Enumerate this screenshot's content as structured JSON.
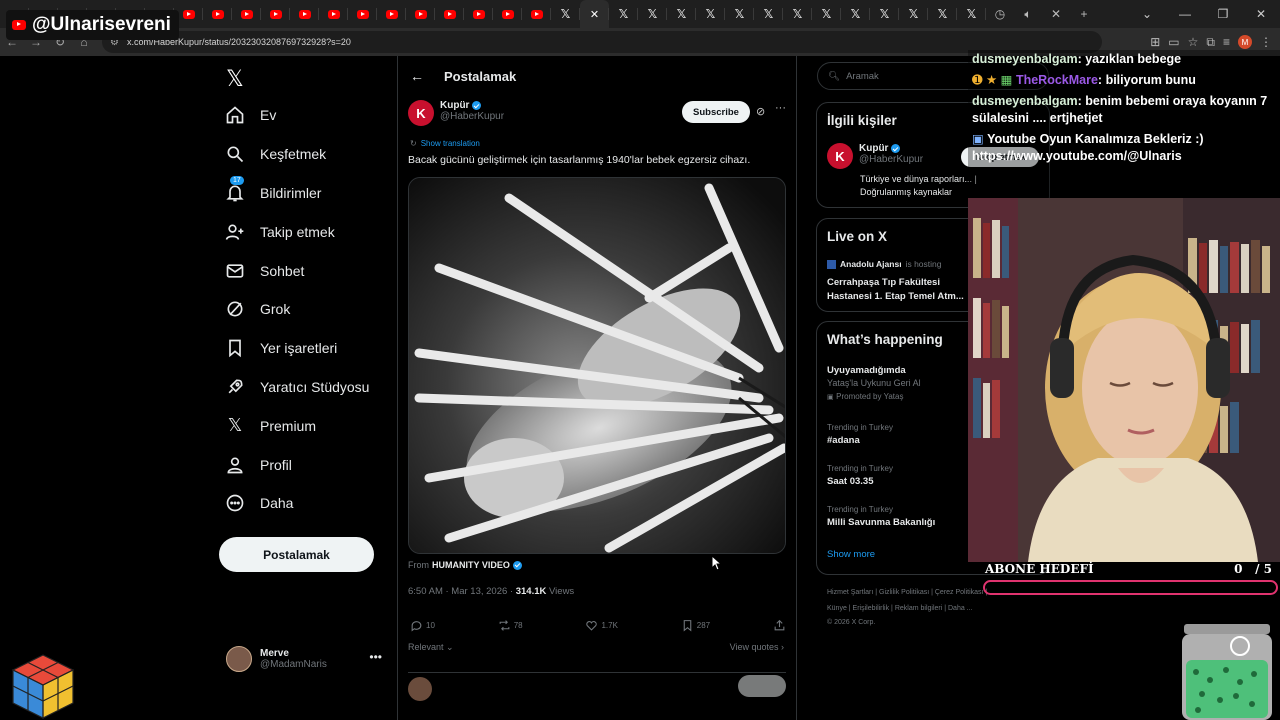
{
  "stream": {
    "channel_badge": "@Ulnarisevreni",
    "chat": [
      {
        "user": "dusmeyenbalgam",
        "text": "yazıklan bebege"
      },
      {
        "user": "TheRockMare",
        "text": "biliyorum bunu"
      },
      {
        "user": "dusmeyenbalgam",
        "text": "benim bebemi oraya koyanın 7 sülalesini .... ertjhetjet"
      },
      {
        "user": "",
        "text": "Youtube Oyun Kanalımıza Bekleriz :) https://www.youtube.com/@Ulnaris"
      }
    ],
    "goal_label": "ABONE HEDEFİ",
    "goal_current": "0",
    "goal_sep": "/",
    "goal_target": "5",
    "goal_fraction": 0
  },
  "browser": {
    "url": "x.com/HaberKupur/status/2032303208769732928?s=20"
  },
  "nav": {
    "items": [
      {
        "label": "Ev",
        "icon": "home-icon"
      },
      {
        "label": "Keşfetmek",
        "icon": "search-icon"
      },
      {
        "label": "Bildirimler",
        "icon": "bell-icon",
        "badge": "17"
      },
      {
        "label": "Takip etmek",
        "icon": "add-user-icon"
      },
      {
        "label": "Sohbet",
        "icon": "mail-icon"
      },
      {
        "label": "Grok",
        "icon": "grok-icon"
      },
      {
        "label": "Yer işaretleri",
        "icon": "bookmark-icon"
      },
      {
        "label": "Yaratıcı Stüdyosu",
        "icon": "rocket-icon"
      },
      {
        "label": "Premium",
        "icon": "x-logo-icon"
      },
      {
        "label": "Profil",
        "icon": "person-icon"
      },
      {
        "label": "Daha",
        "icon": "more-circle-icon"
      }
    ],
    "post_button": "Postalamak",
    "profile_name": "Merve",
    "profile_handle": "@MadamNaris"
  },
  "main": {
    "header_title": "Postalamak",
    "author_name": "Kupür",
    "author_handle": "@HaberKupur",
    "author_initial": "K",
    "subscribe": "Subscribe",
    "show_translation": "Show translation",
    "text": "Bacak gücünü geliştirmek için tasarlanmış 1940'lar bebek egzersiz cihazı.",
    "from_label": "From",
    "from_source": "HUMANITY VIDEO",
    "time": "6:50 AM · Mar 13, 2026 ·",
    "views_count": "314.1K",
    "views_label": "Views",
    "replies": "10",
    "reposts": "78",
    "likes": "1.7K",
    "bookmarks": "287",
    "relevant": "Relevant",
    "view_quotes": "View quotes"
  },
  "right": {
    "search_placeholder": "Aramak",
    "related_title": "İlgili kişiler",
    "related_name": "Kupür",
    "related_handle": "@HaberKupur",
    "related_desc": "Türkiye ve dünya raporları... | Doğrulanmış kaynaklar",
    "follow": "Takip etmek",
    "live_title": "Live on X",
    "live_host": "Anadolu Ajansı",
    "live_host_suffix": "is hosting",
    "live_event": "Cerrahpaşa Tıp Fakültesi Hastanesi 1. Etap Temel Atm...",
    "happening_title": "What’s happening",
    "trends": [
      {
        "context": "",
        "title": "Uyuyamadığımda",
        "sub": "Yataş'la Uykunu Geri Al",
        "extra": "Promoted by Yataş"
      },
      {
        "context": "Trending in Turkey",
        "title": "#adana",
        "sub": "",
        "extra": ""
      },
      {
        "context": "Trending in Turkey",
        "title": "Saat 03.35",
        "sub": "",
        "extra": ""
      },
      {
        "context": "Trending in Turkey",
        "title": "Milli Savunma Bakanlığı",
        "sub": "",
        "extra": ""
      }
    ],
    "show_more": "Show more",
    "footer_line1": "Hizmet Şartları | Gizlilik Politikası | Çerez Politikası |",
    "footer_line2": "Künye | Erişilebilirlik | Reklam bilgileri | Daha ...",
    "footer_line3": "© 2026 X Corp."
  },
  "colors": {
    "accent": "#1d9bf0",
    "goal_border": "#e0336f",
    "background": "#000000"
  }
}
